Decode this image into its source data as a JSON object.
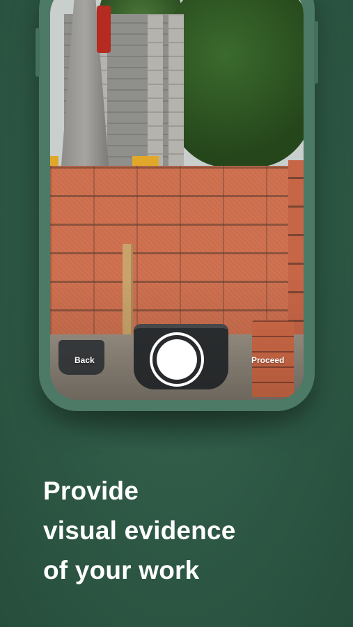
{
  "camera": {
    "back_label": "Back",
    "proceed_label": "Proceed",
    "shutter_icon": "shutter-circle-icon"
  },
  "headline": {
    "line1": "Provide",
    "line2": "visual evidence",
    "line3": "of your work"
  },
  "colors": {
    "background": "#2f5b47",
    "phone_frame": "#4c7a66",
    "text": "#ffffff"
  }
}
